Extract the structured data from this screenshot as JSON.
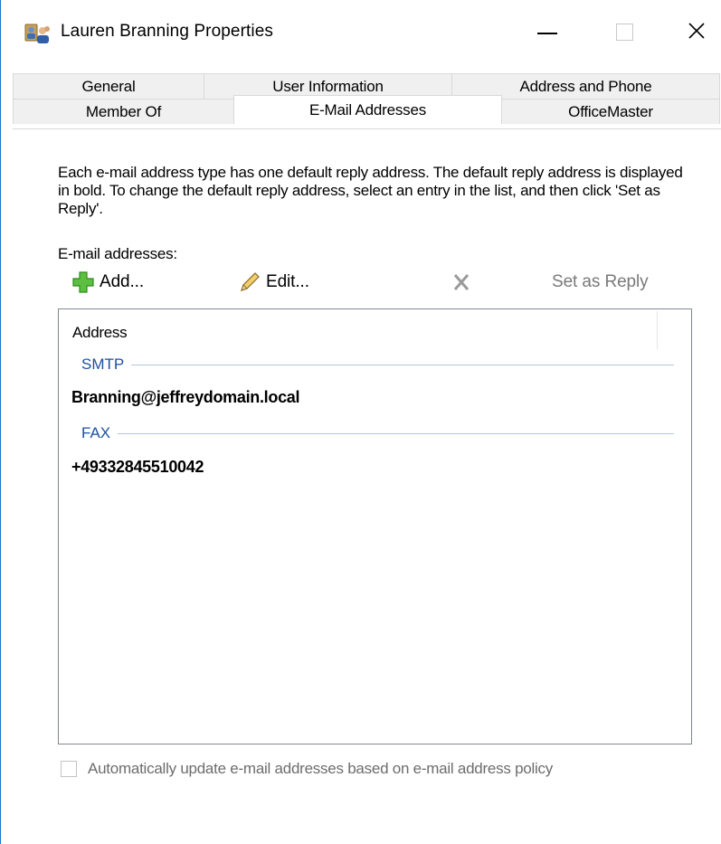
{
  "window": {
    "title": "Lauren Branning Properties",
    "icon": "users-icon"
  },
  "tabs": {
    "row1": [
      "General",
      "User Information",
      "Address and Phone"
    ],
    "row2": [
      "Member Of",
      "E-Mail Addresses",
      "OfficeMaster"
    ],
    "active": "E-Mail Addresses"
  },
  "content": {
    "description": "Each e-mail address type has one default reply address. The default reply address is displayed in bold. To change the default reply address, select an entry in the list, and then click 'Set as Reply'.",
    "section_label": "E-mail addresses:"
  },
  "toolbar": {
    "add_label": "Add...",
    "edit_label": "Edit...",
    "set_reply_label": "Set as Reply"
  },
  "list": {
    "column_header": "Address",
    "groups": [
      {
        "name": "SMTP",
        "entries": [
          "Branning@jeffreydomain.local"
        ]
      },
      {
        "name": "FAX",
        "entries": [
          "+49332845510042"
        ]
      }
    ]
  },
  "options": {
    "auto_update_label": "Automatically update e-mail addresses based on e-mail address policy",
    "auto_update_checked": false
  },
  "colors": {
    "group_header": "#1e50a2",
    "add_icon": "#4caf3b",
    "window_border": "#1979ca"
  }
}
